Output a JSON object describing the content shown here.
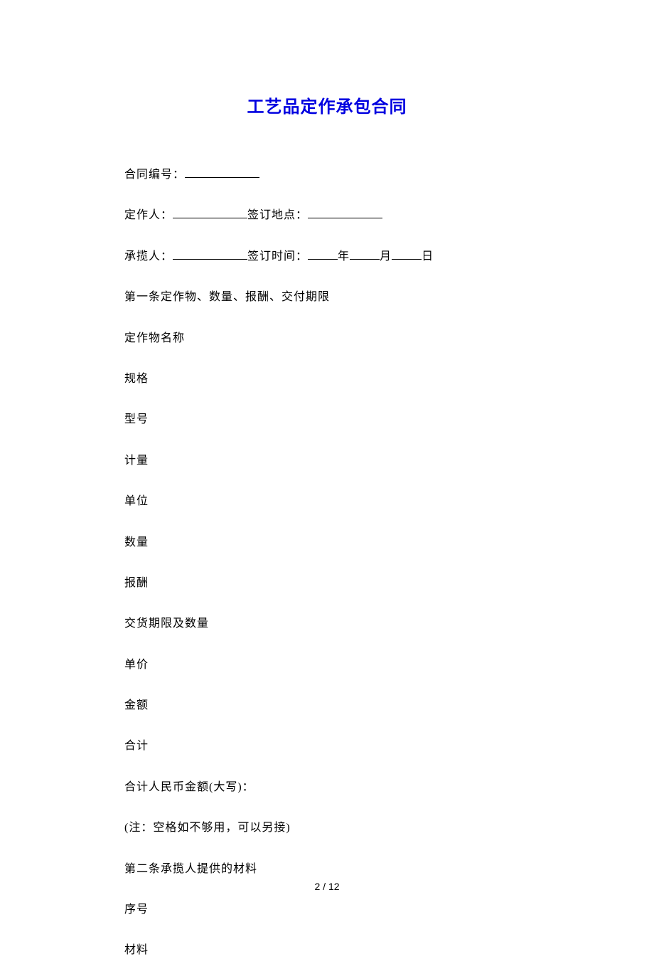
{
  "title": "工艺品定作承包合同",
  "lines": {
    "contract_no_label": "合同编号：",
    "party_a_label": "定作人：",
    "sign_place_label": "签订地点：",
    "party_b_label": "承揽人：",
    "sign_time_label": "签订时间：",
    "year": "年",
    "month": "月",
    "day": "日",
    "article1": "第一条定作物、数量、报酬、交付期限",
    "item_name": "定作物名称",
    "spec": "规格",
    "model": "型号",
    "measure": "计量",
    "unit": "单位",
    "quantity": "数量",
    "remuneration": "报酬",
    "delivery": "交货期限及数量",
    "unit_price": "单价",
    "amount": "金额",
    "total": "合计",
    "total_rmb": "合计人民币金额(大写)：",
    "note": "(注：空格如不够用，可以另接)",
    "article2": "第二条承揽人提供的材料",
    "seq": "序号",
    "material": "材料"
  },
  "footer": {
    "page_current": "2",
    "page_sep": " / ",
    "page_total": "12"
  }
}
